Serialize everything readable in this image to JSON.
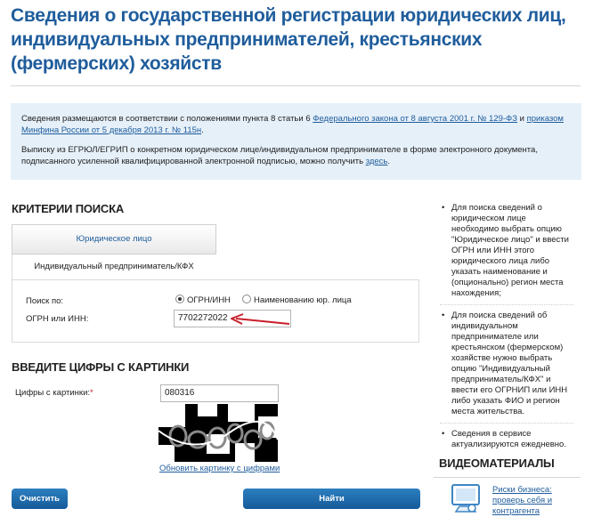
{
  "page": {
    "title": "Сведения о государственной регистрации юридических лиц, индивидуальных предпринимателей, крестьянских (фермерских) хозяйств"
  },
  "info": {
    "p1_before": "Сведения размещаются в соответствии с положениями пункта 8 статьи 6 ",
    "p1_link1": "Федерального закона от 8 августа 2001 г. № 129-ФЗ",
    "p1_and": " и ",
    "p1_link2": "приказом Минфина России от 5 декабря 2013 г. № 115н",
    "p1_after": ".",
    "p2_before": "Выписку из ЕГРЮЛ/ЕГРИП о конкретном юридическом лице/индивидуальном предпринимателе в форме электронного документа, подписанного усиленной квалифицированной электронной подписью, можно получить ",
    "p2_link": "здесь",
    "p2_after": "."
  },
  "search": {
    "heading": "Критерии поиска",
    "tab_legal": "Юридическое лицо",
    "tab_individual": "Индивидуальный предприниматель/КФХ",
    "search_by_label": "Поиск по:",
    "radio_ogrn": "ОГРН/ИНН",
    "radio_name": "Наименованию юр. лица",
    "ogrn_label": "ОГРН или ИНН:",
    "ogrn_value": "7702272022"
  },
  "captcha": {
    "heading": "Введите цифры с картинки",
    "label": "Цифры с картинки:",
    "required_mark": "*",
    "value": "080316",
    "refresh_link": "Обновить картинку с цифрами"
  },
  "buttons": {
    "clear": "Очистить",
    "find": "Найти"
  },
  "sidebar": {
    "items": [
      "Для поиска сведений о юридическом лице необходимо выбрать опцию \"Юридическое лицо\" и ввести ОГРН или ИНН этого юридического лица либо указать наименование и (опционально) регион места нахождения;",
      "Для поиска сведений об индивидуальном предпринимателе или крестьянском (фермерском) хозяйстве нужно выбрать опцию \"Индивидуальный предприниматель/КФХ\" и ввести его ОГРНИП или ИНН либо указать ФИО и регион места жительства.",
      "Сведения в сервисе актуализируются ежедневно."
    ],
    "video_heading": "Видеоматериалы",
    "video_link": "Риски бизнеса: проверь себя и контрагента",
    "video_icon": "monitor-video-icon"
  },
  "colors": {
    "accent": "#1f5d9c",
    "info_bg": "#e6f0f9",
    "button": "#1c6aad",
    "arrow": "#c8202b",
    "required": "#c8202b"
  }
}
